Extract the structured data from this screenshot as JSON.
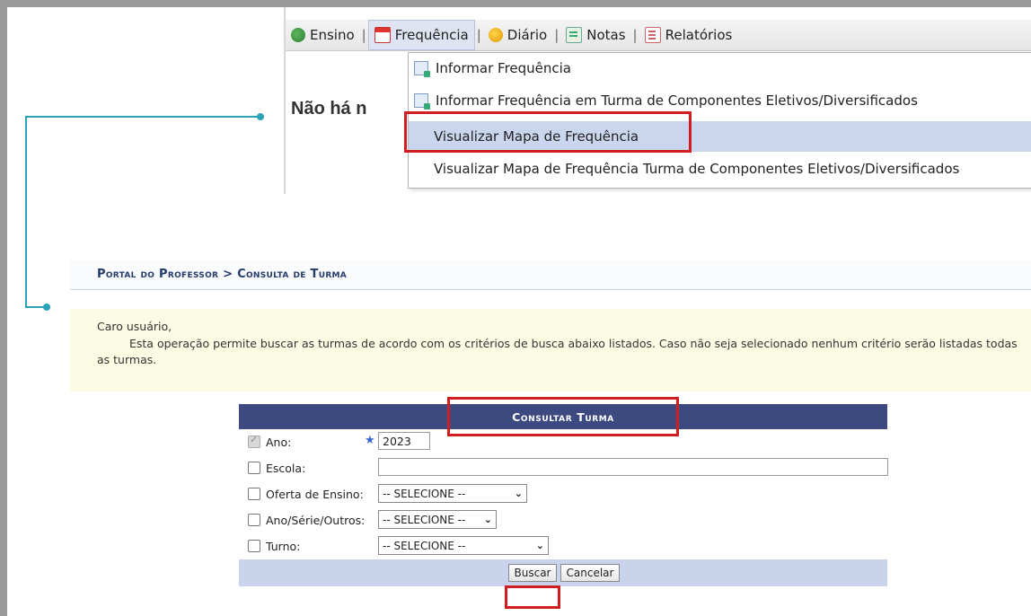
{
  "menu": {
    "items": [
      {
        "label": "Ensino",
        "icon": "graduation-cap-icon"
      },
      {
        "label": "Frequência",
        "icon": "calendar-icon"
      },
      {
        "label": "Diário",
        "icon": "diary-icon"
      },
      {
        "label": "Notas",
        "icon": "grades-icon"
      },
      {
        "label": "Relatórios",
        "icon": "report-icon"
      }
    ],
    "separator": "|"
  },
  "background_text": "Não há n",
  "dropdown": {
    "items": [
      {
        "label": "Informar Frequência"
      },
      {
        "label": "Informar Frequência em Turma de Componentes Eletivos/Diversificados"
      },
      {
        "label": "Visualizar Mapa de Frequência"
      },
      {
        "label": "Visualizar Mapa de Frequência Turma de Componentes Eletivos/Diversificados"
      }
    ]
  },
  "breadcrumb": "Portal do Professor > Consulta de Turma",
  "notice": {
    "greeting": "Caro usuário,",
    "message": "Esta operação permite buscar as turmas de acordo com os critérios de busca abaixo listados. Caso não seja selecionado nenhum critério serão listadas todas as turmas."
  },
  "form": {
    "title": "Consultar Turma",
    "fields": {
      "ano": {
        "label": "Ano:",
        "required_mark": "★",
        "value": "2023"
      },
      "escola": {
        "label": "Escola:",
        "value": ""
      },
      "oferta": {
        "label": "Oferta de Ensino:",
        "selected": "-- SELECIONE --"
      },
      "serie": {
        "label": "Ano/Série/Outros:",
        "selected": "-- SELECIONE --"
      },
      "turno": {
        "label": "Turno:",
        "selected": "-- SELECIONE --"
      }
    },
    "buttons": {
      "search": "Buscar",
      "cancel": "Cancelar"
    }
  },
  "colors": {
    "highlight_box": "#d01d20",
    "connector": "#2aa3b8",
    "form_header": "#3d4a80",
    "notice_bg": "#fcfce4"
  }
}
